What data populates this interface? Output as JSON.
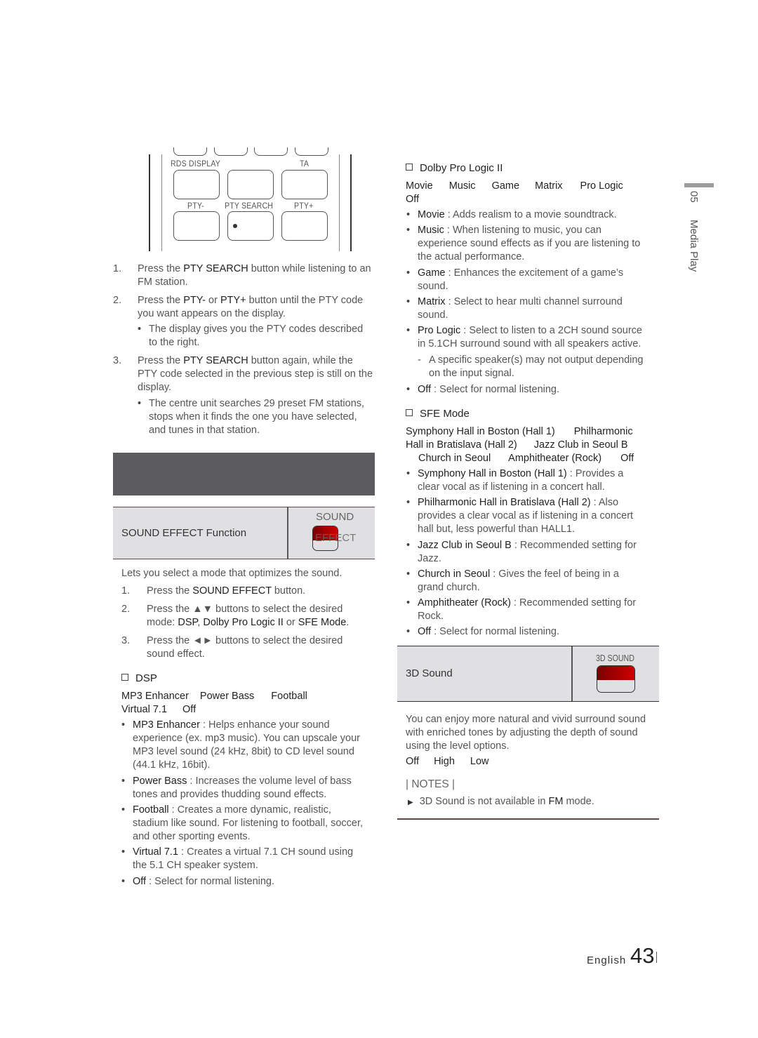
{
  "remote": {
    "labels": {
      "rds_display": "RDS DISPLAY",
      "ta": "TA",
      "pty_minus": "PTY-",
      "pty_search": "PTY SEARCH",
      "pty_plus": "PTY+"
    }
  },
  "pty_steps": [
    {
      "num": "1.",
      "pre": "Press the ",
      "bold": "PTY SEARCH",
      "post": " button while listening to an",
      "line2": "FM station."
    },
    {
      "num": "2.",
      "pre": "Press the ",
      "bold": "PTY-",
      "mid": " or ",
      "bold2": "PTY+",
      "post": " button until the PTY code",
      "line2": "you want appears on the display."
    },
    {
      "num": "3.",
      "pre": "Press the ",
      "bold": "PTY SEARCH",
      "post": " button again, while the",
      "line2": "PTY code selected in the previous step is still on the",
      "line3": "display."
    }
  ],
  "pty_notes": [
    {
      "line1": "The display gives you the PTY codes described",
      "line2": "to the right."
    },
    {
      "line1": "The centre unit searches 29 preset FM stations,",
      "line2": "stops when it finds the one you have selected,",
      "line3": "and tunes in that station."
    }
  ],
  "sound_effect": {
    "title": "SOUND EFFECT Function",
    "icon_label_top": "SOUND",
    "icon_label_bottom": "EFFECT",
    "intro": "Lets you select a mode that optimizes the sound.",
    "steps": [
      {
        "num": "1.",
        "pre": "Press the ",
        "bold": "SOUND EFFECT",
        "post": " button."
      },
      {
        "num": "2.",
        "line1": "Press the ▲▼ buttons to select the desired",
        "l2pre": "mode: ",
        "b1": "DSP",
        "s1": ", ",
        "b2": "Dolby Pro Logic II",
        "s2": "  or ",
        "b3": "SFE Mode",
        "s3": "."
      },
      {
        "num": "3.",
        "line1": "Press the ◄► buttons to select the desired",
        "line2": "sound effect."
      }
    ]
  },
  "dsp": {
    "heading": "DSP",
    "options_line1": [
      "MP3 Enhancer",
      "Power Bass",
      "Football"
    ],
    "options_line2": [
      "Virtual 7.1",
      "Off"
    ],
    "items": [
      {
        "name": "MP3 Enhancer",
        "desc": " : Helps enhance your sound",
        "l2": "experience (ex. mp3 music). You can upscale your",
        "l3": "MP3 level sound (24 kHz, 8bit) to CD level sound",
        "l4": "(44.1 kHz, 16bit)."
      },
      {
        "name": "Power Bass",
        "desc": " : Increases the volume level of bass",
        "l2": "tones and provides thudding sound effects."
      },
      {
        "name": "Football",
        "desc": " : Creates a more dynamic, realistic,",
        "l2": "stadium like sound. For listening to football, soccer,",
        "l3": "and other sporting events."
      },
      {
        "name": "Virtual 7.1",
        "desc": " : Creates a virtual 7.1 CH sound using",
        "l2": "the 5.1 CH speaker system."
      },
      {
        "name": "Off",
        "desc": " : Select for normal listening."
      }
    ]
  },
  "dolby": {
    "heading": "Dolby Pro Logic II",
    "options_line1": [
      "Movie",
      "Music",
      "Game",
      "Matrix",
      "Pro Logic"
    ],
    "options_line2": [
      "Off"
    ],
    "items": [
      {
        "name": "Movie",
        "desc": " : Adds realism to a movie soundtrack."
      },
      {
        "name": "Music",
        "desc": " : When listening to music, you can",
        "l2": "experience sound effects as if you are listening to",
        "l3": "the actual performance."
      },
      {
        "name": "Game",
        "desc": " : Enhances the excitement of a game’s",
        "l2": "sound."
      },
      {
        "name": "Matrix",
        "desc": " : Select to hear multi channel surround",
        "l2": "sound."
      },
      {
        "name": "Pro Logic",
        "desc": " : Select to listen to a 2CH sound source",
        "l2": "in 5.1CH surround sound with all speakers active."
      },
      {
        "name": "Off",
        "desc": " : Select for normal listening."
      }
    ],
    "subnote": {
      "l1": "A specific speaker(s) may not output depending",
      "l2": "on the input signal."
    }
  },
  "sfe": {
    "heading": "SFE Mode",
    "options_line1": [
      "Symphony Hall in Boston (Hall 1)",
      "Philharmonic"
    ],
    "options_line2": [
      "Hall in Bratislava (Hall 2)",
      "Jazz Club in Seoul B"
    ],
    "options_line3": [
      "Church in Seoul",
      "Amphitheater (Rock)",
      "Off"
    ],
    "items": [
      {
        "name": "Symphony Hall in Boston (Hall 1)",
        "desc": "  : Provides a",
        "l2": "clear vocal as if listening in a concert hall."
      },
      {
        "name": "Philharmonic Hall in Bratislava (Hall 2)",
        "desc": "  : Also",
        "l2": "provides a clear vocal as if listening in a concert",
        "l3": "hall but, less powerful than HALL1."
      },
      {
        "name": "Jazz Club in Seoul B",
        "desc": "  : Recommended setting for",
        "l2": "Jazz."
      },
      {
        "name": "Church in Seoul",
        "desc": "  : Gives the feel of being in a",
        "l2": "grand church."
      },
      {
        "name": "Amphitheater (Rock)",
        "desc": "  : Recommended setting for",
        "l2": "Rock."
      },
      {
        "name": "Off",
        "desc": " : Select for normal listening."
      }
    ]
  },
  "sound3d": {
    "title": "3D Sound",
    "icon_label": "3D SOUND",
    "desc_l1": "You can enjoy more natural and vivid surround sound",
    "desc_l2": "with enriched tones by adjusting the depth of sound",
    "desc_l3": "using the level options.",
    "options": [
      "Off",
      "High",
      "Low"
    ],
    "notes_heading": "| NOTES |",
    "note_pre": "3D Sound is not available in ",
    "note_bold": "FM",
    "note_post": " mode."
  },
  "sidebar": {
    "chapter": "05",
    "section": "Media Play"
  },
  "footer": {
    "language": "English",
    "page": "43"
  },
  "colors": {
    "banner": "#5c5c5e",
    "function_box": "#e0e0e2",
    "button_red": "#c00000"
  }
}
